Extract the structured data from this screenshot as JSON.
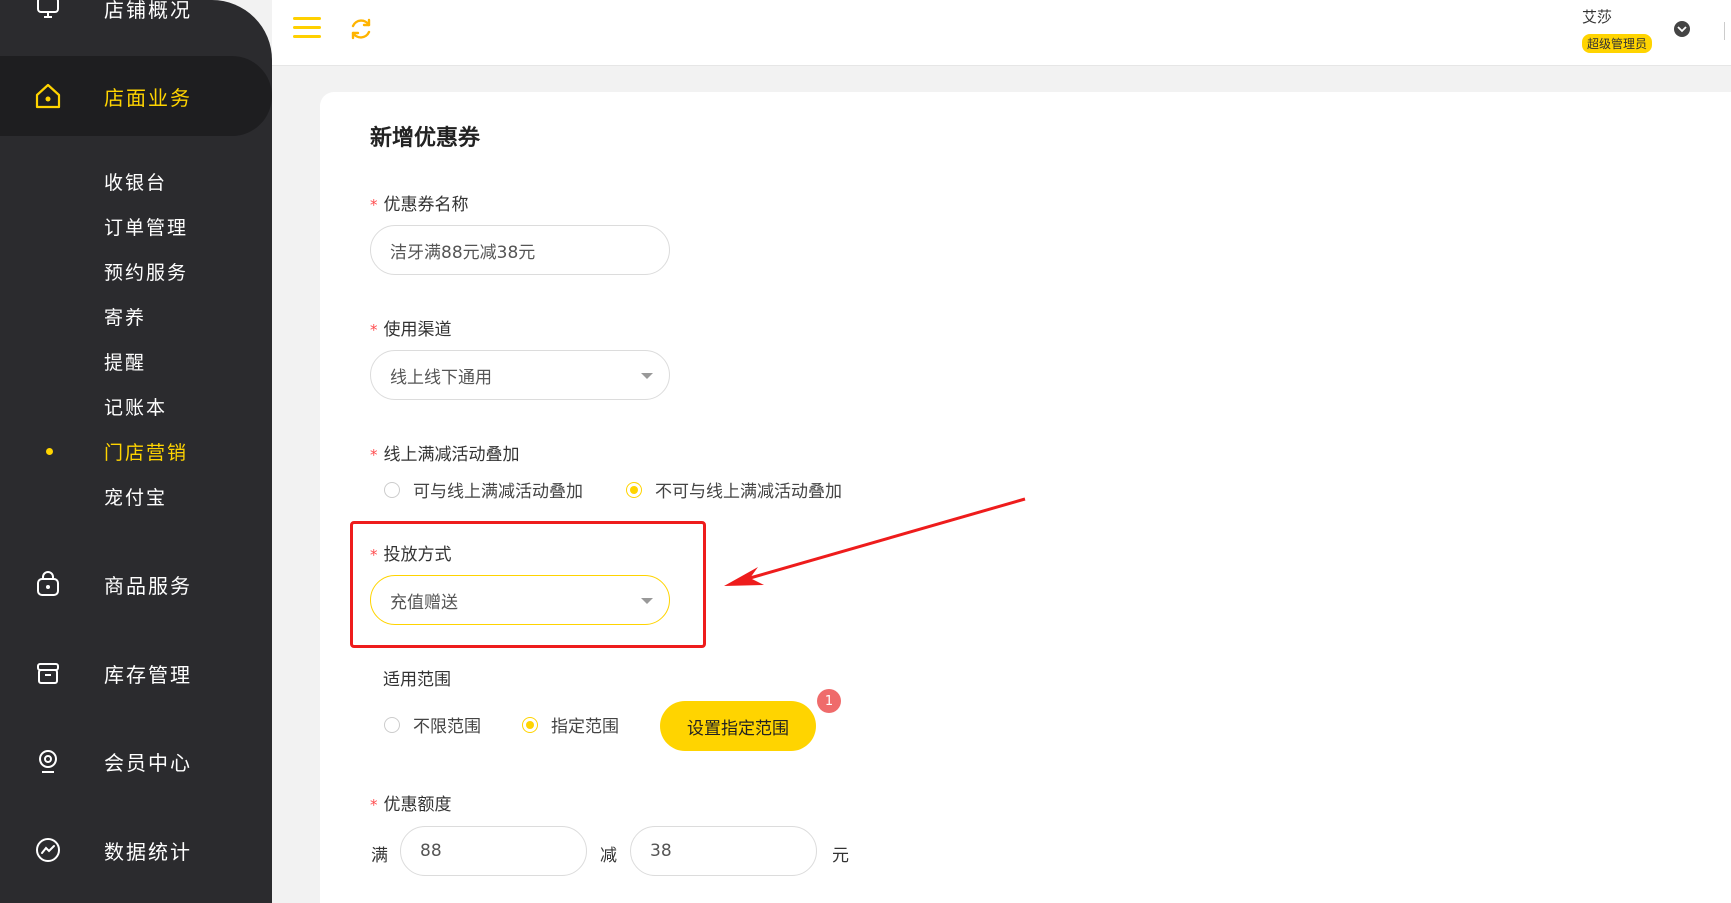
{
  "sidebar": {
    "top_item": "店铺概况",
    "active_group": "店面业务",
    "sub_items": [
      {
        "label": "收银台",
        "active": false
      },
      {
        "label": "订单管理",
        "active": false
      },
      {
        "label": "预约服务",
        "active": false
      },
      {
        "label": "寄养",
        "active": false
      },
      {
        "label": "提醒",
        "active": false
      },
      {
        "label": "记账本",
        "active": false
      },
      {
        "label": "门店营销",
        "active": true
      },
      {
        "label": "宠付宝",
        "active": false
      }
    ],
    "groups": [
      {
        "label": "商品服务",
        "icon": "bag-icon"
      },
      {
        "label": "库存管理",
        "icon": "box-icon"
      },
      {
        "label": "会员中心",
        "icon": "member-icon"
      },
      {
        "label": "数据统计",
        "icon": "chart-icon"
      }
    ]
  },
  "header": {
    "user_name": "艾莎",
    "user_role": "超级管理员"
  },
  "form": {
    "title": "新增优惠券",
    "coupon_name": {
      "label": "优惠券名称",
      "value": "洁牙满88元减38元"
    },
    "channel": {
      "label": "使用渠道",
      "value": "线上线下通用"
    },
    "stacking": {
      "label": "线上满减活动叠加",
      "options": [
        "可与线上满减活动叠加",
        "不可与线上满减活动叠加"
      ],
      "selected": 1
    },
    "delivery": {
      "label": "投放方式",
      "value": "充值赠送"
    },
    "scope": {
      "label": "适用范围",
      "options": [
        "不限范围",
        "指定范围"
      ],
      "selected": 1,
      "button": "设置指定范围",
      "badge": "1"
    },
    "discount": {
      "label": "优惠额度",
      "prefix": "满",
      "threshold": "88",
      "middle": "减",
      "amount": "38",
      "suffix": "元"
    }
  },
  "colors": {
    "accent": "#ffd400",
    "sidebar_bg": "#2b2b2e",
    "required": "#ff4d4f",
    "annotation": "#ee1c1c"
  }
}
